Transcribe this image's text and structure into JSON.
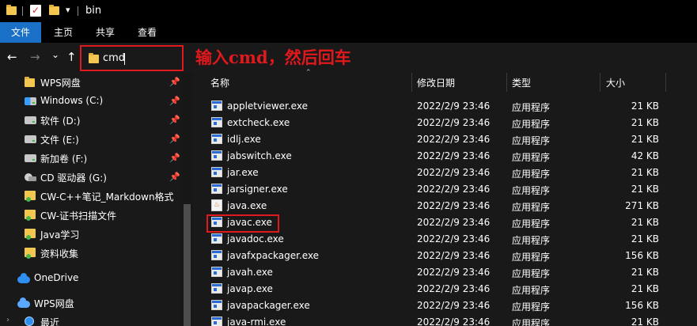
{
  "window": {
    "title": "bin",
    "qa_dropdown_glyph": "▾"
  },
  "ribbon": {
    "tabs": [
      {
        "label": "文件",
        "active": true
      },
      {
        "label": "主页"
      },
      {
        "label": "共享"
      },
      {
        "label": "查看"
      }
    ]
  },
  "address": {
    "value": "cmd",
    "annotation": "输入cmd，然后回车",
    "annotation_color": "#e0191d"
  },
  "nav_buttons": {
    "back": "←",
    "forward": "→",
    "recent": "⌄",
    "up": "↑"
  },
  "sidebar": {
    "items": [
      {
        "label": "WPS网盘",
        "icon": "folder-icon",
        "pinned": true
      },
      {
        "label": "Windows (C:)",
        "icon": "windows-drive-icon",
        "pinned": true
      },
      {
        "label": "软件 (D:)",
        "icon": "drive-icon",
        "pinned": true
      },
      {
        "label": "文件 (E:)",
        "icon": "drive-icon",
        "pinned": true
      },
      {
        "label": "新加卷 (F:)",
        "icon": "drive-icon",
        "pinned": true
      },
      {
        "label": "CD 驱动器 (G:)",
        "icon": "cd-drive-icon",
        "pinned": true
      },
      {
        "label": "CW-C++笔记_Markdown格式",
        "icon": "synced-folder-icon",
        "pinned": false
      },
      {
        "label": "CW-证书扫描文件",
        "icon": "synced-folder-icon",
        "pinned": false
      },
      {
        "label": "Java学习",
        "icon": "synced-folder-icon",
        "pinned": false
      },
      {
        "label": "资料收集",
        "icon": "synced-folder-icon",
        "pinned": false
      },
      {
        "label": "OneDrive",
        "icon": "onedrive-cloud-icon",
        "pinned": false
      },
      {
        "label": "WPS网盘",
        "icon": "wps-cloud-icon",
        "pinned": false
      },
      {
        "label": "最近",
        "icon": "clock-icon",
        "pinned": false
      }
    ]
  },
  "columns": {
    "name": "名称",
    "date": "修改日期",
    "type": "类型",
    "size": "大小"
  },
  "files": [
    {
      "name": "appletviewer.exe",
      "date": "2022/2/9 23:46",
      "type": "应用程序",
      "size": "21 KB",
      "icon": "exe-icon"
    },
    {
      "name": "extcheck.exe",
      "date": "2022/2/9 23:46",
      "type": "应用程序",
      "size": "21 KB",
      "icon": "exe-icon"
    },
    {
      "name": "idlj.exe",
      "date": "2022/2/9 23:46",
      "type": "应用程序",
      "size": "21 KB",
      "icon": "exe-icon"
    },
    {
      "name": "jabswitch.exe",
      "date": "2022/2/9 23:46",
      "type": "应用程序",
      "size": "42 KB",
      "icon": "exe-icon"
    },
    {
      "name": "jar.exe",
      "date": "2022/2/9 23:46",
      "type": "应用程序",
      "size": "21 KB",
      "icon": "exe-icon"
    },
    {
      "name": "jarsigner.exe",
      "date": "2022/2/9 23:46",
      "type": "应用程序",
      "size": "21 KB",
      "icon": "exe-icon"
    },
    {
      "name": "java.exe",
      "date": "2022/2/9 23:46",
      "type": "应用程序",
      "size": "271 KB",
      "icon": "java-icon"
    },
    {
      "name": "javac.exe",
      "date": "2022/2/9 23:46",
      "type": "应用程序",
      "size": "21 KB",
      "icon": "exe-icon",
      "highlighted": true
    },
    {
      "name": "javadoc.exe",
      "date": "2022/2/9 23:46",
      "type": "应用程序",
      "size": "21 KB",
      "icon": "exe-icon"
    },
    {
      "name": "javafxpackager.exe",
      "date": "2022/2/9 23:46",
      "type": "应用程序",
      "size": "156 KB",
      "icon": "exe-icon"
    },
    {
      "name": "javah.exe",
      "date": "2022/2/9 23:46",
      "type": "应用程序",
      "size": "21 KB",
      "icon": "exe-icon"
    },
    {
      "name": "javap.exe",
      "date": "2022/2/9 23:46",
      "type": "应用程序",
      "size": "21 KB",
      "icon": "exe-icon"
    },
    {
      "name": "javapackager.exe",
      "date": "2022/2/9 23:46",
      "type": "应用程序",
      "size": "156 KB",
      "icon": "exe-icon"
    },
    {
      "name": "java-rmi.exe",
      "date": "2022/2/9 23:46",
      "type": "应用程序",
      "size": "21 KB",
      "icon": "exe-icon"
    }
  ],
  "colors": {
    "accent": "#1a6fc6",
    "highlight": "#e0191d",
    "background": "#191919"
  }
}
